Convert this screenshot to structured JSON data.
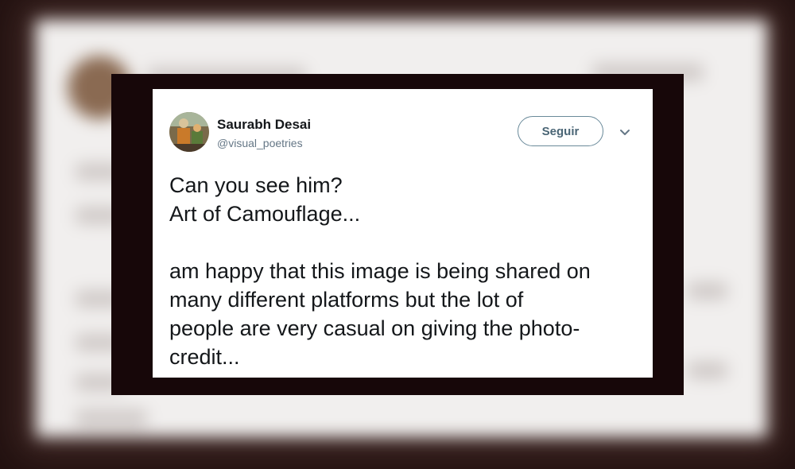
{
  "tweet": {
    "display_name": "Saurabh Desai",
    "handle": "@visual_poetries",
    "follow_label": "Seguir",
    "text_lines": [
      "Can you see him?",
      "Art of Camouflage..."
    ],
    "body_lines": [
      "am happy that this image is being shared on",
      "many different platforms but the lot of",
      "people are very casual on giving the photo-",
      "credit..."
    ],
    "icons": {
      "avatar": "avatar-photo",
      "menu": "chevron-down-icon"
    }
  },
  "colors": {
    "frame": "#170709",
    "card": "#ffffff",
    "name": "#14171a",
    "handle": "#657786",
    "follow_border": "#6a8a9a"
  }
}
